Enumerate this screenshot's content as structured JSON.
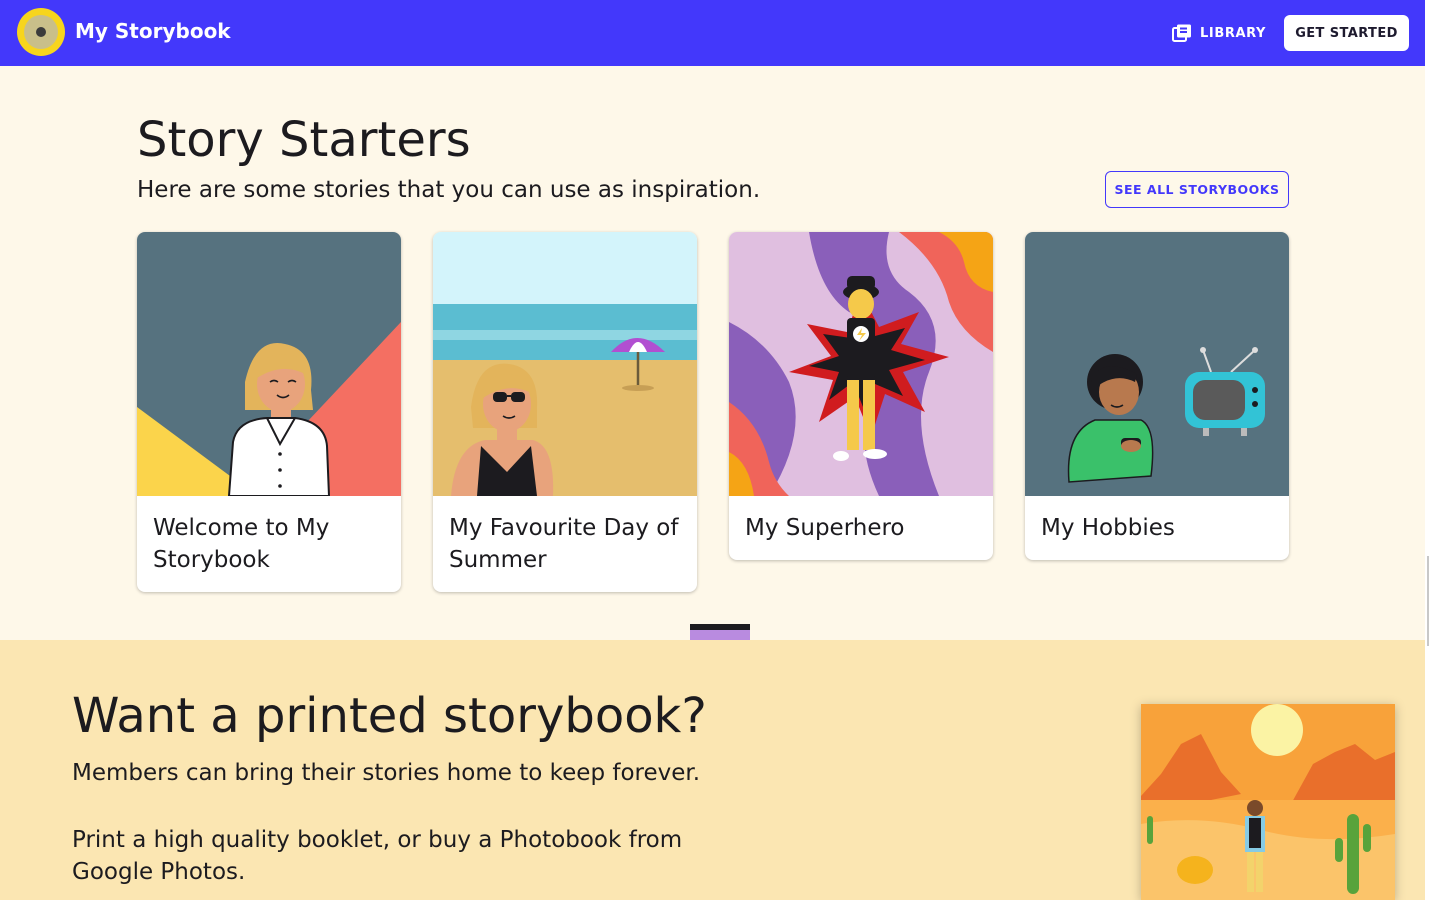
{
  "header": {
    "app_title": "My Storybook",
    "library_label": "LIBRARY",
    "get_started_label": "GET STARTED",
    "logo_icon": "camera-lens-icon",
    "library_icon": "library-books-icon"
  },
  "story_starters": {
    "title": "Story Starters",
    "subtitle": "Here are some stories that you can use as inspiration.",
    "see_all_label": "SEE ALL STORYBOOKS",
    "cards": [
      {
        "title": "Welcome to My Storybook",
        "illustration": "woman-white-shirt-illustration"
      },
      {
        "title": "My Favourite Day of Summer",
        "illustration": "woman-beach-sunglasses-illustration"
      },
      {
        "title": "My Superhero",
        "illustration": "superhero-illustration"
      },
      {
        "title": "My Hobbies",
        "illustration": "boy-gamer-tv-illustration"
      }
    ]
  },
  "print_section": {
    "title": "Want a printed storybook?",
    "paragraph_1": "Members can bring their stories home to keep forever.",
    "paragraph_2": "Print a high quality booklet, or buy a Photobook from Google Photos.",
    "illustration": "desert-traveler-illustration"
  },
  "colors": {
    "brand": "#4338fb",
    "page_background": "#fef8e9",
    "print_band": "#fbe6b2",
    "logo_yellow": "#f7d51d"
  }
}
